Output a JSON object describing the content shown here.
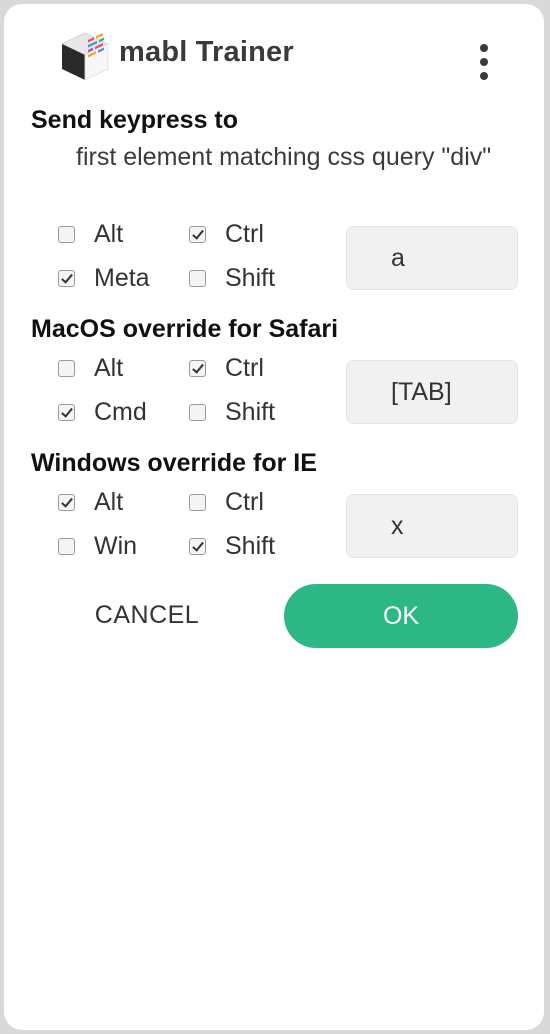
{
  "header": {
    "title": "mabl Trainer",
    "menu_icon": "more-vertical-icon",
    "logo_icon": "mabl-logo-icon"
  },
  "send_keypress": {
    "title": "Send keypress to",
    "target": "first element matching css query \"div\"",
    "modifiers": [
      {
        "label": "Alt",
        "checked": false
      },
      {
        "label": "Ctrl",
        "checked": true
      },
      {
        "label": "Meta",
        "checked": true
      },
      {
        "label": "Shift",
        "checked": false
      }
    ],
    "key": "a"
  },
  "macos_override": {
    "title": "MacOS override for Safari",
    "modifiers": [
      {
        "label": "Alt",
        "checked": false
      },
      {
        "label": "Ctrl",
        "checked": true
      },
      {
        "label": "Cmd",
        "checked": true
      },
      {
        "label": "Shift",
        "checked": false
      }
    ],
    "key": "[TAB]"
  },
  "windows_override": {
    "title": "Windows override for IE",
    "modifiers": [
      {
        "label": "Alt",
        "checked": true
      },
      {
        "label": "Ctrl",
        "checked": false
      },
      {
        "label": "Win",
        "checked": false
      },
      {
        "label": "Shift",
        "checked": true
      }
    ],
    "key": "x"
  },
  "actions": {
    "cancel_label": "CANCEL",
    "ok_label": "OK"
  },
  "colors": {
    "accent": "#2db784",
    "background": "#ffffff",
    "text": "#333333"
  }
}
